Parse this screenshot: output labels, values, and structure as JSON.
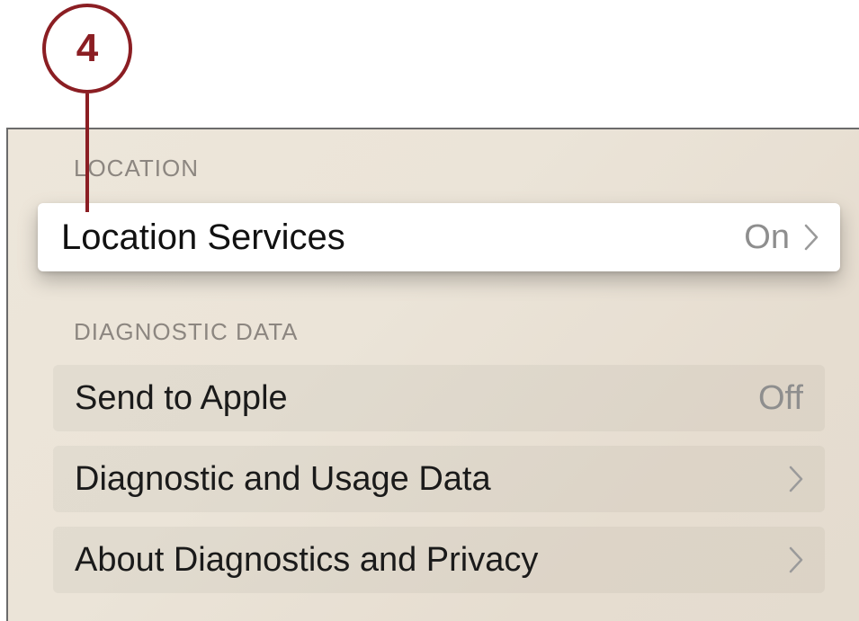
{
  "callout": {
    "number": "4"
  },
  "sections": [
    {
      "header": "LOCATION",
      "rows": [
        {
          "label": "Location Services",
          "value": "On",
          "icon": "chevron-right-icon",
          "focused": true
        }
      ]
    },
    {
      "header": "DIAGNOSTIC DATA",
      "rows": [
        {
          "label": "Send to Apple",
          "value": "Off"
        },
        {
          "label": "Diagnostic and Usage Data",
          "icon": "chevron-right-icon"
        },
        {
          "label": "About Diagnostics and Privacy",
          "icon": "chevron-right-icon"
        }
      ]
    }
  ],
  "colors": {
    "callout": "#8b1e23",
    "focused_row": "#ffffff",
    "header_text": "#8c8680",
    "value_text": "#8e8e8e"
  }
}
